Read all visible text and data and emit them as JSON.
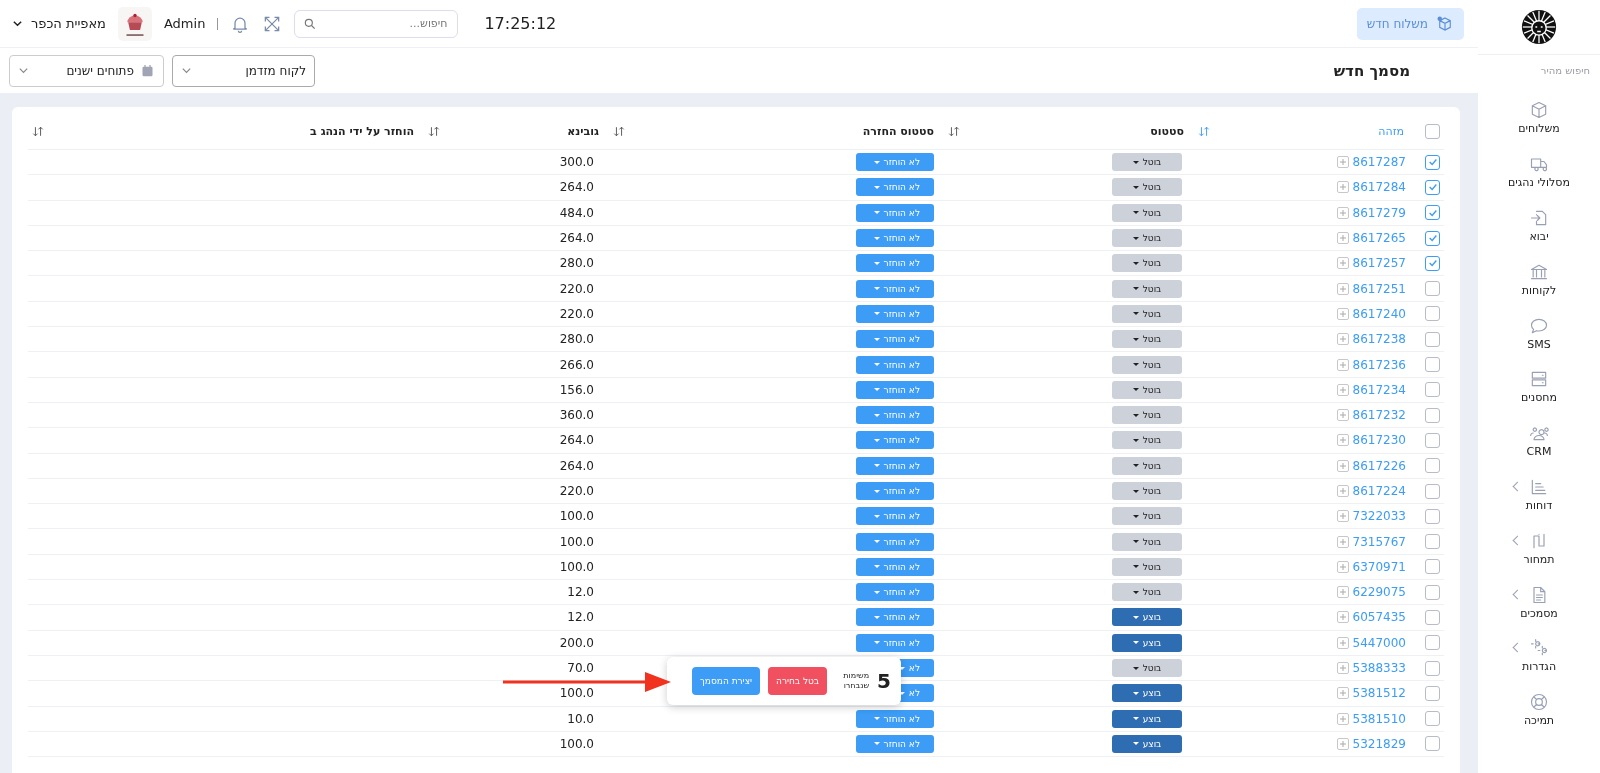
{
  "sidebar": {
    "quick_search": "חיפוש מהיר",
    "items": [
      {
        "label": "משלוחים",
        "expandable": false
      },
      {
        "label": "מסלולי נהגים",
        "expandable": false
      },
      {
        "label": "יבוא",
        "expandable": false
      },
      {
        "label": "לקוחות",
        "expandable": false
      },
      {
        "label": "SMS",
        "expandable": false
      },
      {
        "label": "מחסנים",
        "expandable": false
      },
      {
        "label": "CRM",
        "expandable": false
      },
      {
        "label": "דוחות",
        "expandable": true
      },
      {
        "label": "תמחור",
        "expandable": true
      },
      {
        "label": "מסמכים",
        "expandable": true
      },
      {
        "label": "הגדרות",
        "expandable": true
      },
      {
        "label": "תמיכה",
        "expandable": false
      }
    ]
  },
  "top_bar": {
    "new_shipment": "משלוח חדש",
    "time": "17:25:12",
    "search": {
      "placeholder": "חיפוש..."
    },
    "user": "Admin",
    "business": "מאפיית הכפר"
  },
  "page": {
    "title": "מסמך חדש",
    "customer_select": "לקוח מזדמן",
    "date_select": "פתוחים ישנים"
  },
  "table": {
    "select_all": false,
    "columns": [
      {
        "label": "מזהה",
        "sort_active": true
      },
      {
        "label": "סטטוס",
        "sort_active": false
      },
      {
        "label": "סטטוס החזרה",
        "sort_active": false
      },
      {
        "label": "גובינא",
        "sort_active": false
      },
      {
        "label": "הוחזר על ידי הנהג ב",
        "sort_active": false
      }
    ],
    "rows": [
      {
        "checked": true,
        "id": "8617287",
        "status": {
          "kind": "cancelled",
          "label": "בוטל"
        },
        "return_status": "לא הוחזר",
        "weight": "300.0"
      },
      {
        "checked": true,
        "id": "8617284",
        "status": {
          "kind": "cancelled",
          "label": "בוטל"
        },
        "return_status": "לא הוחזר",
        "weight": "264.0"
      },
      {
        "checked": true,
        "id": "8617279",
        "status": {
          "kind": "cancelled",
          "label": "בוטל"
        },
        "return_status": "לא הוחזר",
        "weight": "484.0"
      },
      {
        "checked": true,
        "id": "8617265",
        "status": {
          "kind": "cancelled",
          "label": "בוטל"
        },
        "return_status": "לא הוחזר",
        "weight": "264.0"
      },
      {
        "checked": true,
        "id": "8617257",
        "status": {
          "kind": "cancelled",
          "label": "בוטל"
        },
        "return_status": "לא הוחזר",
        "weight": "280.0"
      },
      {
        "checked": false,
        "id": "8617251",
        "status": {
          "kind": "cancelled",
          "label": "בוטל"
        },
        "return_status": "לא הוחזר",
        "weight": "220.0"
      },
      {
        "checked": false,
        "id": "8617240",
        "status": {
          "kind": "cancelled",
          "label": "בוטל"
        },
        "return_status": "לא הוחזר",
        "weight": "220.0"
      },
      {
        "checked": false,
        "id": "8617238",
        "status": {
          "kind": "cancelled",
          "label": "בוטל"
        },
        "return_status": "לא הוחזר",
        "weight": "280.0"
      },
      {
        "checked": false,
        "id": "8617236",
        "status": {
          "kind": "cancelled",
          "label": "בוטל"
        },
        "return_status": "לא הוחזר",
        "weight": "266.0"
      },
      {
        "checked": false,
        "id": "8617234",
        "status": {
          "kind": "cancelled",
          "label": "בוטל"
        },
        "return_status": "לא הוחזר",
        "weight": "156.0"
      },
      {
        "checked": false,
        "id": "8617232",
        "status": {
          "kind": "cancelled",
          "label": "בוטל"
        },
        "return_status": "לא הוחזר",
        "weight": "360.0"
      },
      {
        "checked": false,
        "id": "8617230",
        "status": {
          "kind": "cancelled",
          "label": "בוטל"
        },
        "return_status": "לא הוחזר",
        "weight": "264.0"
      },
      {
        "checked": false,
        "id": "8617226",
        "status": {
          "kind": "cancelled",
          "label": "בוטל"
        },
        "return_status": "לא הוחזר",
        "weight": "264.0"
      },
      {
        "checked": false,
        "id": "8617224",
        "status": {
          "kind": "cancelled",
          "label": "בוטל"
        },
        "return_status": "לא הוחזר",
        "weight": "220.0"
      },
      {
        "checked": false,
        "id": "7322033",
        "status": {
          "kind": "cancelled",
          "label": "בוטל"
        },
        "return_status": "לא הוחזר",
        "weight": "100.0"
      },
      {
        "checked": false,
        "id": "7315767",
        "status": {
          "kind": "cancelled",
          "label": "בוטל"
        },
        "return_status": "לא הוחזר",
        "weight": "100.0"
      },
      {
        "checked": false,
        "id": "6370971",
        "status": {
          "kind": "cancelled",
          "label": "בוטל"
        },
        "return_status": "לא הוחזר",
        "weight": "100.0"
      },
      {
        "checked": false,
        "id": "6229075",
        "status": {
          "kind": "cancelled",
          "label": "בוטל"
        },
        "return_status": "לא הוחזר",
        "weight": "12.0"
      },
      {
        "checked": false,
        "id": "6057435",
        "status": {
          "kind": "done",
          "label": "בוצע"
        },
        "return_status": "לא הוחזר",
        "weight": "12.0"
      },
      {
        "checked": false,
        "id": "5447000",
        "status": {
          "kind": "done",
          "label": "בוצע"
        },
        "return_status": "לא הוחזר",
        "weight": "200.0"
      },
      {
        "checked": false,
        "id": "5388333",
        "status": {
          "kind": "cancelled",
          "label": "בוטל"
        },
        "return_status": "לא",
        "weight": "70.0"
      },
      {
        "checked": false,
        "id": "5381512",
        "status": {
          "kind": "done",
          "label": "בוצע"
        },
        "return_status": "לא",
        "weight": "100.0"
      },
      {
        "checked": false,
        "id": "5381510",
        "status": {
          "kind": "done",
          "label": "בוצע"
        },
        "return_status": "לא הוחזר",
        "weight": "10.0"
      },
      {
        "checked": false,
        "id": "5321829",
        "status": {
          "kind": "done",
          "label": "בוצע"
        },
        "return_status": "לא הוחזר",
        "weight": "100.0"
      }
    ]
  },
  "selection_popup": {
    "count": "5",
    "label": "משימות שנבחרו",
    "cancel": "בטל בחירה",
    "create": "יצירת המסמך"
  }
}
